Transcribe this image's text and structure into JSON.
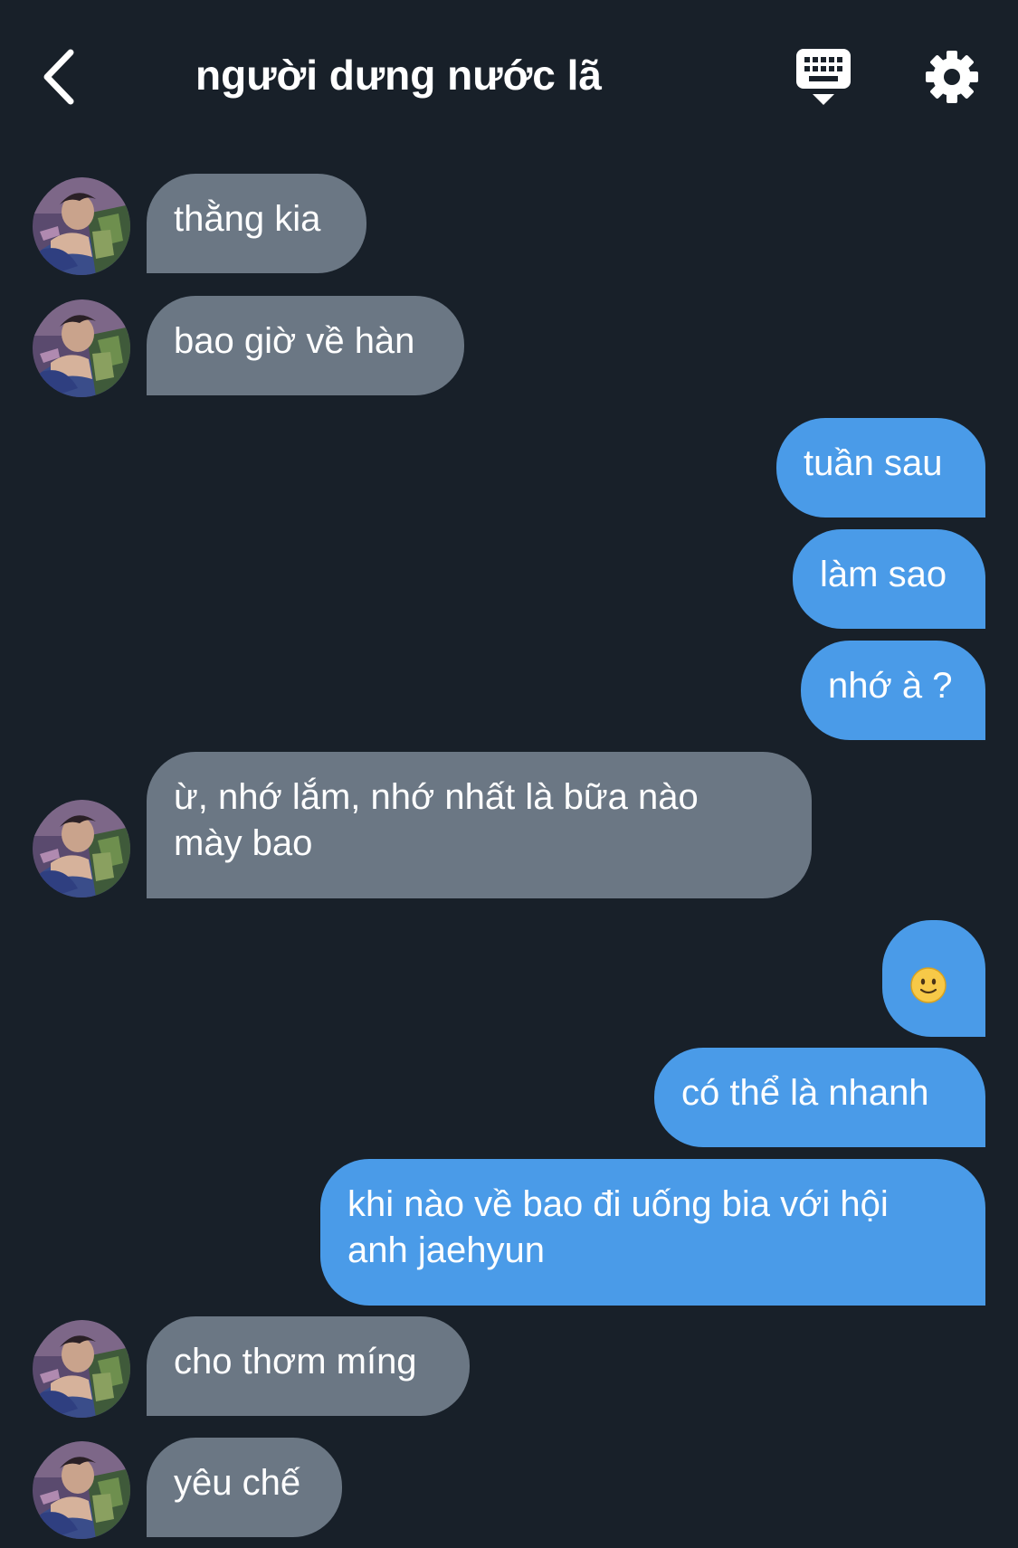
{
  "header": {
    "title": "người dưng nước lã",
    "back_icon": "chevron-left-icon",
    "keyboard_icon": "keyboard-icon",
    "settings_icon": "gear-icon"
  },
  "colors": {
    "background": "#182029",
    "incoming_bubble": "#6b7784",
    "outgoing_bubble": "#4a9be8",
    "text": "#ffffff"
  },
  "messages": [
    {
      "sender": "them",
      "text": "thằng kia"
    },
    {
      "sender": "them",
      "text": "bao giờ về hàn"
    },
    {
      "sender": "me",
      "text": "tuần sau"
    },
    {
      "sender": "me",
      "text": "làm sao"
    },
    {
      "sender": "me",
      "text": "nhớ à ?"
    },
    {
      "sender": "them",
      "text": "ừ, nhớ lắm, nhớ nhất là bữa nào\nmày bao"
    },
    {
      "sender": "me",
      "emoji": "slightly-smiling-face"
    },
    {
      "sender": "me",
      "text": "có thể là nhanh"
    },
    {
      "sender": "me",
      "text": "khi nào về bao đi uống bia với hội\nanh jaehyun"
    },
    {
      "sender": "them",
      "text": "cho thơm míng"
    },
    {
      "sender": "them",
      "text": "yêu chế"
    }
  ]
}
